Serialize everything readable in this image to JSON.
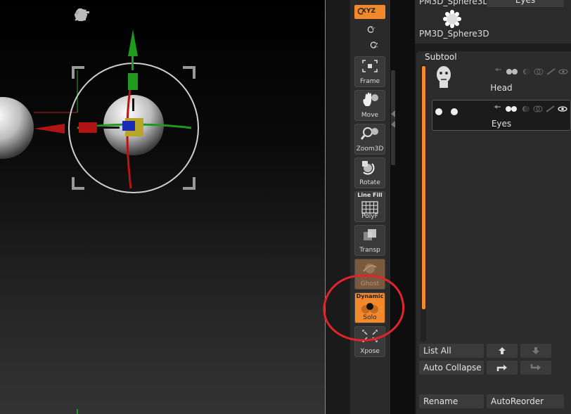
{
  "gizmo_toolbar": {
    "icons": [
      "gear-icon",
      "pin-icon",
      "location-icon",
      "home-icon",
      "reset-icon",
      "lock-icon",
      "check-minus-icon"
    ]
  },
  "shelf": {
    "xyz_label": "XYZ",
    "y_label": "Y",
    "z_label": "Z",
    "frame_label": "Frame",
    "move_label": "Move",
    "zoom_label": "Zoom3D",
    "rotate_label": "Rotate",
    "linefill_top": "Line Fill",
    "polyf_label": "PolyF",
    "transp_label": "Transp",
    "ghost_label": "Ghost",
    "dynamic_top": "Dynamic",
    "solo_label": "Solo",
    "xpose_label": "Xpose"
  },
  "panel": {
    "top_item_label": "PM3D_Sphere3D",
    "top_item_label2": "PM3D_Sphere3D",
    "eyes_tab": "Eyes",
    "subtool_title": "Subtool",
    "rows": [
      {
        "name": "Head"
      },
      {
        "name": "Eyes"
      }
    ],
    "list_all": "List All",
    "auto_collapse": "Auto Collapse",
    "rename": "Rename",
    "auto_reorder": "AutoReorder"
  },
  "colors": {
    "accent": "#f28a2b",
    "annotation": "#e0252a"
  }
}
